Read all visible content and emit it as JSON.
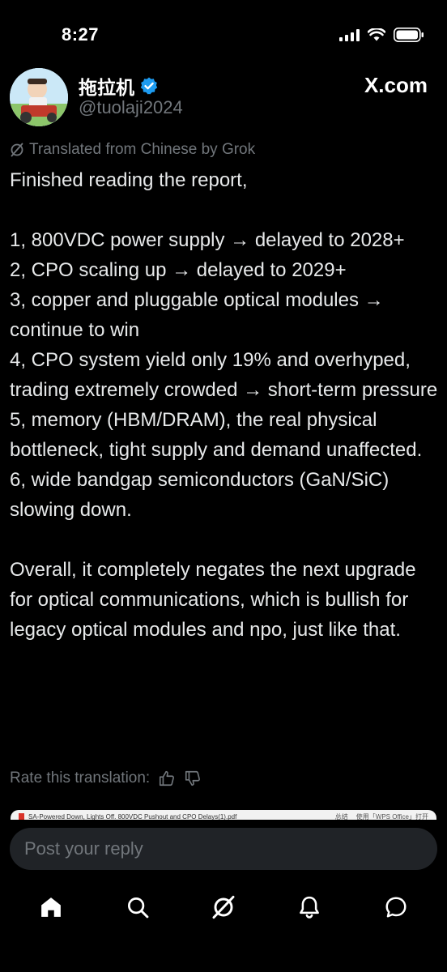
{
  "status_bar": {
    "time": "8:27"
  },
  "header": {
    "display_name": "拖拉机",
    "handle": "@tuolaji2024",
    "site": "X.com",
    "verified_color": "#1d9bf0"
  },
  "translated_label": "Translated from Chinese by Grok",
  "tweet": {
    "paragraphs": [
      "Finished reading the report,",
      "",
      "1, 800VDC power supply → delayed to 2028+",
      "2, CPO scaling up → delayed to 2029+",
      "3, copper and pluggable optical modules → continue to win",
      "4, CPO system yield only 19% and overhyped, trading extremely crowded → short-term pressure",
      "5, memory (HBM/DRAM), the real physical bottleneck, tight supply and demand unaffected.",
      "6, wide bandgap semiconductors (GaN/SiC) slowing down.",
      "",
      "Overall, it completely negates the next upgrade for optical communications, which is bullish for legacy optical modules and npo, just like that."
    ]
  },
  "rate_translation": "Rate this translation:",
  "pdf_preview": {
    "filename": "SA-Powered Down, Lights Off. 800VDC Pushout and CPO Delays(1).pdf",
    "right_text_1": "总结",
    "right_text_2": "使用「WPS Office」打开"
  },
  "reply": {
    "placeholder": "Post your reply"
  },
  "icons": {
    "home": "home-icon",
    "search": "search-icon",
    "grok": "grok-icon",
    "notifications": "bell-icon",
    "messages": "message-icon"
  },
  "colors": {
    "background": "#000000",
    "text": "#e7e9ea",
    "muted": "#71767b",
    "input_bg": "#202327"
  }
}
